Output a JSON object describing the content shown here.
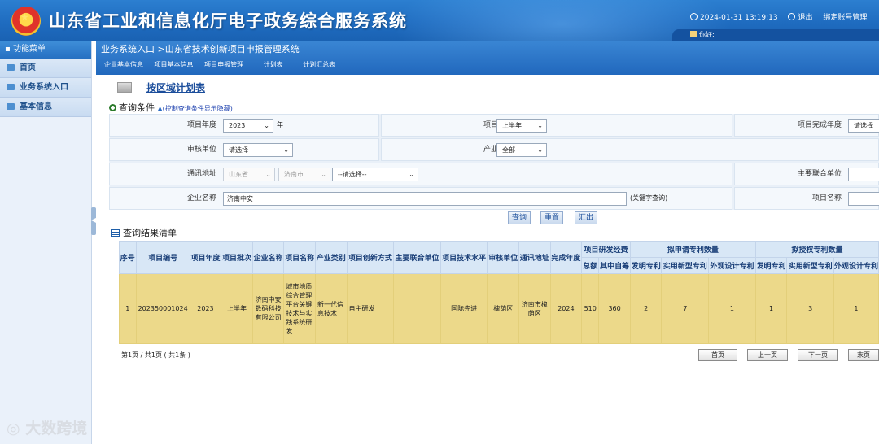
{
  "header": {
    "title": "山东省工业和信息化厅电子政务综合服务系统",
    "datetime": "2024-01-31 13:19:13",
    "logout": "退出",
    "bind_account": "绑定账号管理",
    "greeting": "你好:"
  },
  "sidebar": {
    "title": "功能菜单",
    "items": [
      {
        "label": "首页"
      },
      {
        "label": "业务系统入口"
      },
      {
        "label": "基本信息"
      }
    ]
  },
  "main": {
    "breadcrumb": "业务系统入口 >山东省技术创新项目申报管理系统",
    "subtabs": [
      "企业基本信息",
      "项目基本信息",
      "项目申报管理",
      "计划表",
      "计划汇总表"
    ],
    "page_title": "按区域计划表",
    "query_label": "查询条件",
    "query_toggle": "(控制查询条件显示隐藏)",
    "form": {
      "year_label": "项目年度",
      "year_value": "2023",
      "year_unit": "年",
      "batch_label": "项目批次",
      "batch_value": "上半年",
      "finish_year_label": "项目完成年度",
      "finish_year_value": "请选择",
      "audit_unit_label": "审核单位",
      "audit_unit_value": "请选择",
      "industry_label": "产业类别",
      "industry_value": "全部",
      "address_label": "通讯地址",
      "province_value": "山东省",
      "city_value": "济南市",
      "district_value": "--请选择--",
      "joint_unit_label": "主要联合单位",
      "company_label": "企业名称",
      "company_value": "济南中安",
      "keyword_hint": "(关键字查询)",
      "project_name_label": "项目名称"
    },
    "buttons": {
      "query": "查询",
      "reset": "重置",
      "export": "汇出"
    },
    "result_title": "查询结果清单",
    "table": {
      "headers": {
        "seq": "序号",
        "code": "项目编号",
        "year": "项目年度",
        "batch": "项目批次",
        "company": "企业名称",
        "name": "项目名称",
        "industry": "产业类别",
        "innovation": "项目创新方式",
        "joint": "主要联合单位",
        "tech_level": "项目技术水平",
        "audit": "审核单位",
        "address": "通讯地址",
        "finish": "完成年度",
        "funds": "项目研发经费",
        "funds_total": "总额",
        "funds_self": "其中自筹",
        "apply_patent": "拟申请专利数量",
        "grant_patent": "拟授权专利数量",
        "invention": "发明专利",
        "utility": "实用新型专利",
        "design": "外观设计专利"
      },
      "rows": [
        {
          "seq": "1",
          "code": "202350001024",
          "year": "2023",
          "batch": "上半年",
          "company": "济南中安数码科技有限公司",
          "name": "城市地质综合管理平台关键技术与实践系统研发",
          "industry": "新一代信息技术",
          "innovation": "自主研发",
          "joint": "",
          "tech_level": "国际先进",
          "audit": "槐荫区",
          "address": "济南市槐荫区",
          "finish": "2024",
          "total": "510",
          "self": "360",
          "apply_invention": "2",
          "apply_utility": "7",
          "apply_design": "1",
          "grant_invention": "1",
          "grant_utility": "3",
          "grant_design": "1"
        }
      ]
    },
    "pager": {
      "info": "第1页 / 共1页 ( 共1条 )",
      "first": "首页",
      "prev": "上一页",
      "next": "下一页",
      "last": "末页"
    }
  },
  "watermark": "大数跨境"
}
